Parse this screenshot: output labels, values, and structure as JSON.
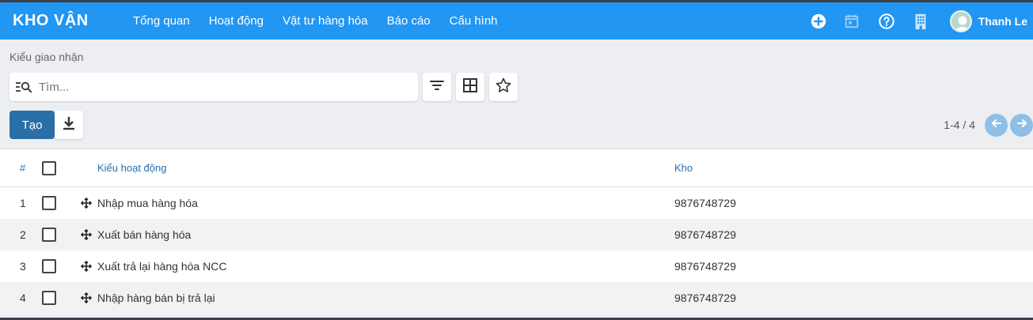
{
  "app": {
    "title": "KHO VẬN"
  },
  "menu": [
    {
      "label": "Tổng quan"
    },
    {
      "label": "Hoạt động"
    },
    {
      "label": "Vật tư hàng hóa"
    },
    {
      "label": "Báo cáo"
    },
    {
      "label": "Cấu hình"
    }
  ],
  "user": {
    "name": "Thanh Le"
  },
  "icons": {
    "add": "plus-circle-icon",
    "calendar": "calendar-icon",
    "help": "help-circle-icon",
    "company": "building-icon"
  },
  "page": {
    "breadcrumb": "Kiểu giao nhận"
  },
  "search": {
    "placeholder": "Tìm...",
    "value": ""
  },
  "actions": {
    "create_label": "Tạo"
  },
  "pager": {
    "text": "1-4 / 4"
  },
  "table": {
    "headers": {
      "index": "#",
      "operation_type": "Kiểu hoạt động",
      "warehouse": "Kho"
    },
    "rows": [
      {
        "index": "1",
        "operation_type": "Nhập mua hàng hóa",
        "warehouse": "9876748729"
      },
      {
        "index": "2",
        "operation_type": "Xuất bán hàng hóa",
        "warehouse": "9876748729"
      },
      {
        "index": "3",
        "operation_type": "Xuất trả lại hàng hóa NCC",
        "warehouse": "9876748729"
      },
      {
        "index": "4",
        "operation_type": "Nhập hàng bán bị trả lại",
        "warehouse": "9876748729"
      }
    ]
  },
  "colors": {
    "navbar": "#2196f3",
    "primary_button": "#2a6fa8",
    "header_text": "#2a6fa8",
    "pager_button": "#8fbfe6"
  }
}
